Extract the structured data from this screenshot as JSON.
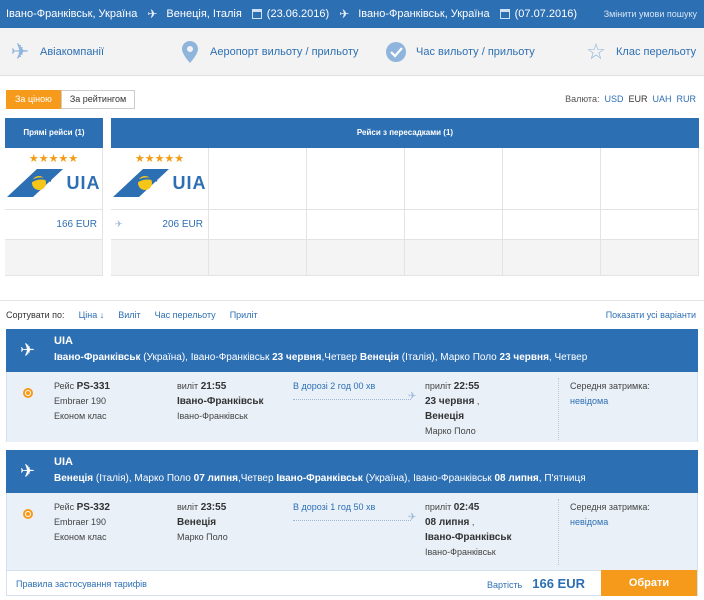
{
  "search": {
    "origin": "Івано-Франківськ, Україна",
    "destination": "Венеція, Італія",
    "date_out": "(23.06.2016)",
    "return": "Івано-Франківськ, Україна",
    "date_back": "(07.07.2016)",
    "change_label": "Змінити умови пошуку"
  },
  "filters": {
    "airlines": "Авіакомпанії",
    "airport": "Аеропорт вильоту / прильоту",
    "time": "Час вильоту / прильоту",
    "class": "Клас перельоту"
  },
  "sort_buttons": {
    "by_price": "За ціною",
    "by_rating": "За рейтингом"
  },
  "currency": {
    "label": "Валюта:",
    "options": [
      "USD",
      "EUR",
      "UAH",
      "RUR"
    ],
    "selected": "EUR"
  },
  "grid": {
    "direct_header": "Прямі рейси (1)",
    "transfer_header": "Рейси з пересадками (1)",
    "direct_stars": "★★★★★",
    "transfer_stars": "★★★★★",
    "logo_text": "UIA",
    "direct_price": "166 EUR",
    "transfer_price": "206 EUR",
    "transfer_icon": "✈"
  },
  "sortbar": {
    "label": "Сортувати по:",
    "price": "Ціна ↓",
    "departure": "Виліт",
    "duration": "Час перельоту",
    "arrival": "Приліт",
    "show_all": "Показати усі варіанти"
  },
  "legs": [
    {
      "airline": "UIA",
      "route_parts": {
        "from_city": "Івано-Франківськ",
        "from_rest": " (Україна), Івано-Франківськ ",
        "from_date": "23 червня",
        "from_day": ",Четвер ",
        "to_city": "Венеція",
        "to_rest": " (Італія), Марко Поло ",
        "to_date": "23 червня",
        "to_day": ", Четвер"
      },
      "flight_prefix": "Рейс ",
      "flight_no": "PS-331",
      "aircraft": "Embraer 190",
      "cabin": "Економ клас",
      "dep_prefix": "виліт ",
      "dep_time": "21:55",
      "dep_city": "Івано-Франківськ",
      "dep_airport": "Івано-Франківськ",
      "dur_prefix": "В дорозі ",
      "duration": "2 год 00 хв",
      "arr_prefix": "приліт ",
      "arr_time": "22:55",
      "arr_date": "23 червня",
      "arr_city": "Венеція",
      "arr_airport": "Марко Поло",
      "delay_label": "Середня затримка:",
      "delay_value": "невідома"
    },
    {
      "airline": "UIA",
      "route_parts": {
        "from_city": "Венеція",
        "from_rest": " (Італія), Марко Поло ",
        "from_date": "07 липня",
        "from_day": ",Четвер ",
        "to_city": "Івано-Франківськ",
        "to_rest": " (Україна), Івано-Франківськ ",
        "to_date": "08 липня",
        "to_day": ", П'ятниця"
      },
      "flight_prefix": "Рейс ",
      "flight_no": "PS-332",
      "aircraft": "Embraer 190",
      "cabin": "Економ клас",
      "dep_prefix": "виліт ",
      "dep_time": "23:55",
      "dep_city": "Венеція",
      "dep_airport": "Марко Поло",
      "dur_prefix": "В дорозі ",
      "duration": "1 год 50 хв",
      "arr_prefix": "приліт ",
      "arr_time": "02:45",
      "arr_date": "08 липня",
      "arr_city": "Івано-Франківськ",
      "arr_airport": "Івано-Франківськ",
      "delay_label": "Середня затримка:",
      "delay_value": "невідома"
    }
  ],
  "footer": {
    "rules": "Правила застосування тарифів",
    "cost_label": "Вартість",
    "cost_value": "166 EUR",
    "choose": "Обрати"
  }
}
